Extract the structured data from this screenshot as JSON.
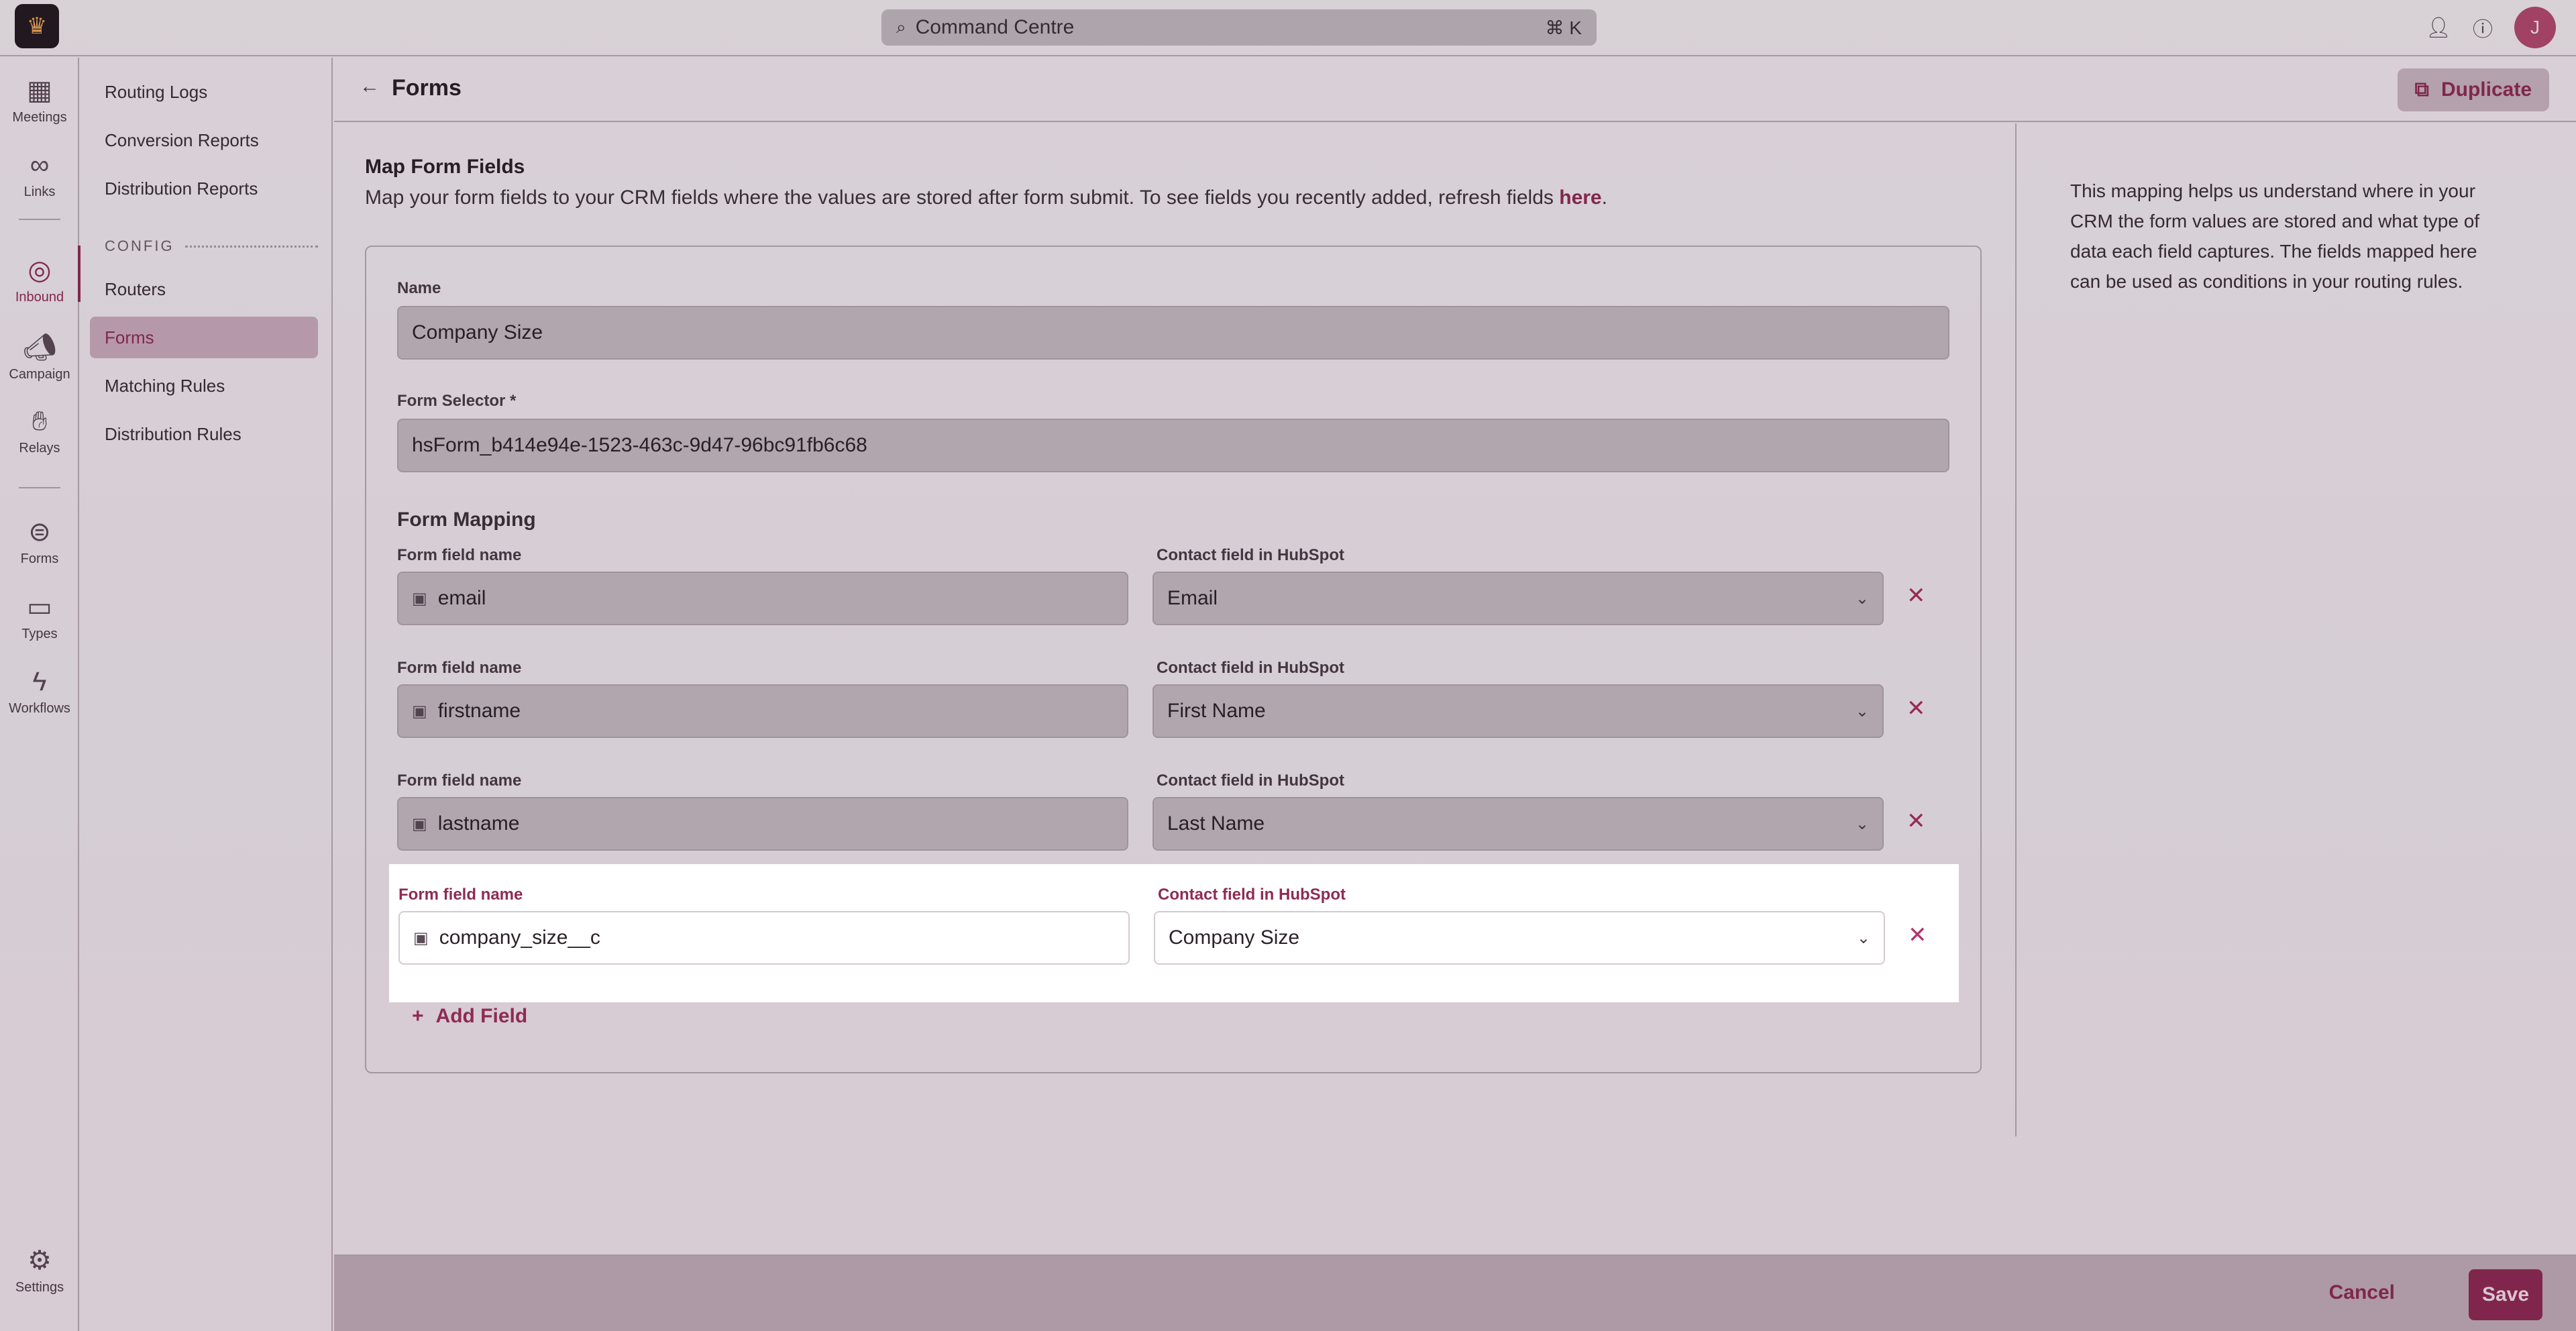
{
  "topbar": {
    "command_placeholder": "Command Centre",
    "shortcut": "⌘ K",
    "avatar_initial": "J"
  },
  "rail": {
    "items": [
      {
        "label": "Meetings",
        "icon": "calendar-icon"
      },
      {
        "label": "Links",
        "icon": "link-icon"
      },
      {
        "label": "Inbound",
        "icon": "target-icon"
      },
      {
        "label": "Campaign",
        "icon": "megaphone-icon"
      },
      {
        "label": "Relays",
        "icon": "relay-icon"
      },
      {
        "label": "Forms",
        "icon": "forms-icon"
      },
      {
        "label": "Types",
        "icon": "video-icon"
      },
      {
        "label": "Workflows",
        "icon": "bolt-icon"
      },
      {
        "label": "Settings",
        "icon": "gear-icon"
      }
    ]
  },
  "subnav": {
    "items_top": [
      "Routing Logs",
      "Conversion Reports",
      "Distribution Reports"
    ],
    "section": "CONFIG",
    "items_config": [
      "Routers",
      "Forms",
      "Matching Rules",
      "Distribution Rules"
    ]
  },
  "header": {
    "title": "Forms",
    "duplicate_label": "Duplicate"
  },
  "form": {
    "section_title": "Map Form Fields",
    "section_desc": "Map your form fields to your CRM fields where the values are stored after form submit. To see fields you recently added, refresh fields ",
    "section_link": "here",
    "section_desc_end": ".",
    "name_label": "Name",
    "name_value": "Company Size",
    "selector_label": "Form Selector *",
    "selector_value": "hsForm_b414e94e-1523-463c-9d47-96bc91fb6c68",
    "mapping_title": "Form Mapping",
    "field_name_label": "Form field name",
    "crm_label": "Contact field in HubSpot",
    "mappings": [
      {
        "form_field": "email",
        "crm_field": "Email"
      },
      {
        "form_field": "firstname",
        "crm_field": "First Name"
      },
      {
        "form_field": "lastname",
        "crm_field": "Last Name"
      },
      {
        "form_field": "company_size__c",
        "crm_field": "Company Size"
      }
    ],
    "add_field_label": "Add Field"
  },
  "help": {
    "text": "This mapping helps us understand where in your CRM the form values are stored and what type of data each field captures. The fields mapped here can be used as conditions in your routing rules."
  },
  "footer": {
    "cancel_label": "Cancel",
    "save_label": "Save"
  },
  "colors": {
    "accent": "#8e2b55",
    "overlay": "#c8c0c6"
  }
}
